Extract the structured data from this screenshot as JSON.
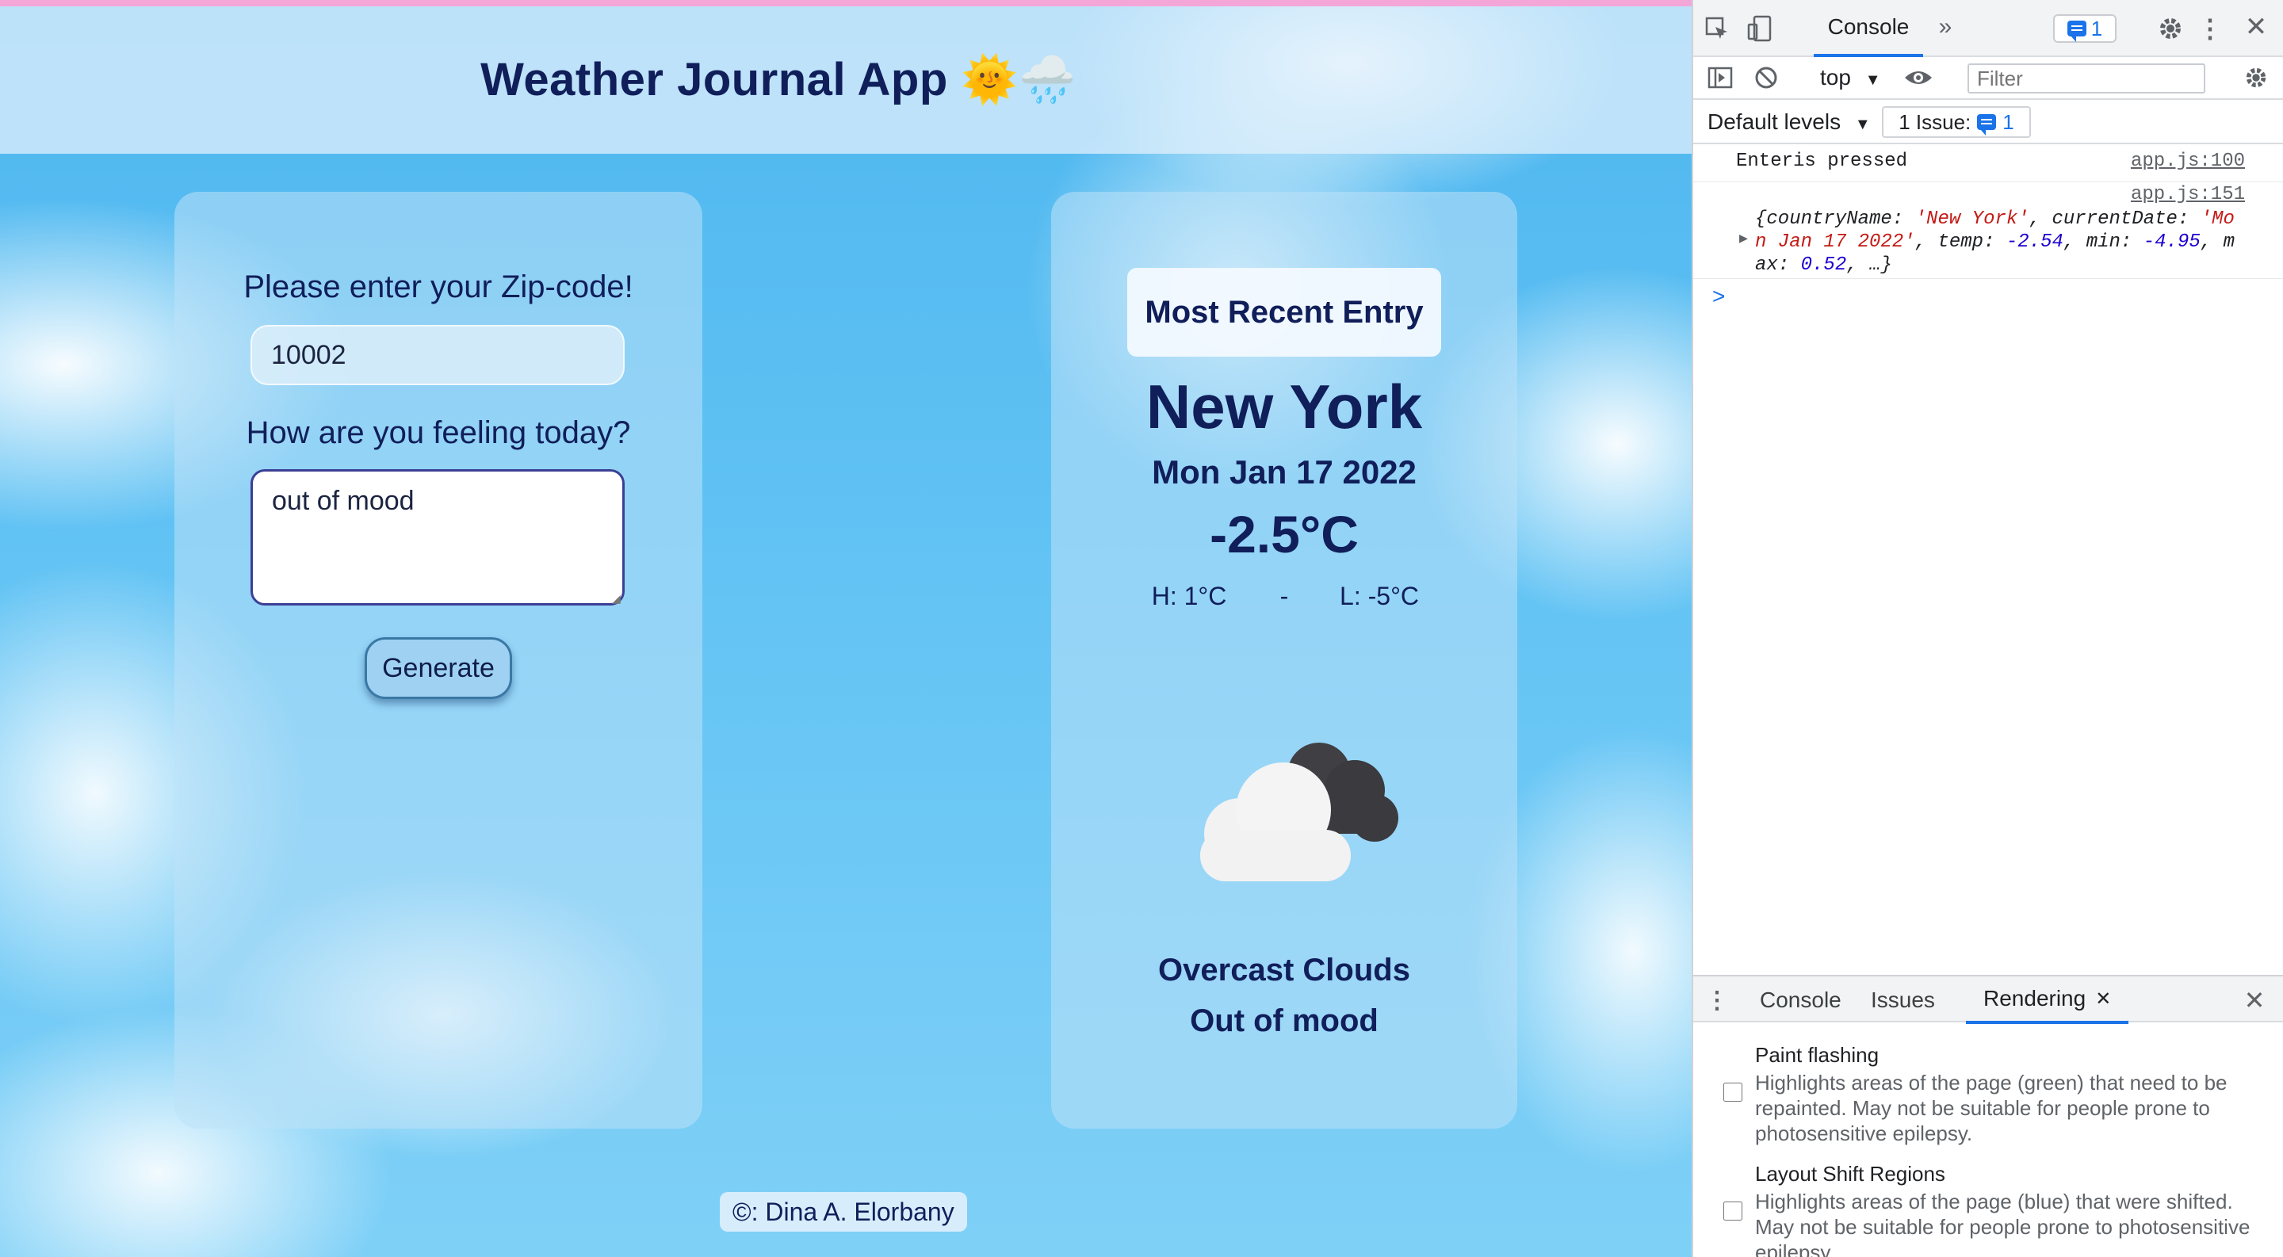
{
  "app": {
    "title": "Weather Journal App 🌞🌧️",
    "zip_label": "Please enter your Zip-code!",
    "zip_value": "10002",
    "feeling_label": "How are you feeling today?",
    "feeling_value": "out of mood",
    "generate_label": "Generate",
    "recent_title": "Most Recent Entry",
    "city": "New York",
    "date": "Mon Jan 17 2022",
    "temp": "-2.5°C",
    "high": "H: 1°C",
    "separator": "-",
    "low": "L: -5°C",
    "weather_icon": "broken-clouds-night-icon",
    "description": "Overcast Clouds",
    "mood": "Out of mood",
    "footer": "©: Dina A. Elorbany"
  },
  "devtools": {
    "tab_console": "Console",
    "more_tabs": "»",
    "issues_count": "1",
    "context": "top",
    "filter_placeholder": "Filter",
    "levels": "Default levels",
    "issue_text": "1 Issue:",
    "issue_num": "1",
    "log1": {
      "message": "Enteris pressed",
      "source": "app.js:100"
    },
    "log2": {
      "source": "app.js:151",
      "line1_prefix": "{",
      "line1_k1": "countryName",
      "line1_v1": "'New York'",
      "line1_k2": "currentDate",
      "line1_v2a": "'Mo",
      "line2_v2b": "n Jan 17 2022'",
      "line2_k3": "temp",
      "line2_v3": "-2.54",
      "line2_k4": "min",
      "line2_v4": "-4.95",
      "line2_k5a": "m",
      "line3_k5b": "ax",
      "line3_v5": "0.52",
      "line3_rest": ", …}"
    },
    "prompt": ">",
    "drawer_tabs": [
      "Console",
      "Issues",
      "Rendering"
    ],
    "rendering_options": [
      {
        "title": "Paint flashing",
        "desc": "Highlights areas of the page (green) that need to be repainted. May not be suitable for people prone to photosensitive epilepsy."
      },
      {
        "title": "Layout Shift Regions",
        "desc": "Highlights areas of the page (blue) that were shifted. May not be suitable for people prone to photosensitive epilepsy."
      }
    ]
  },
  "colors": {
    "title_text": "#101e5a",
    "devtools_accent": "#1a73e8",
    "top_strip": "#f4a6d8"
  }
}
